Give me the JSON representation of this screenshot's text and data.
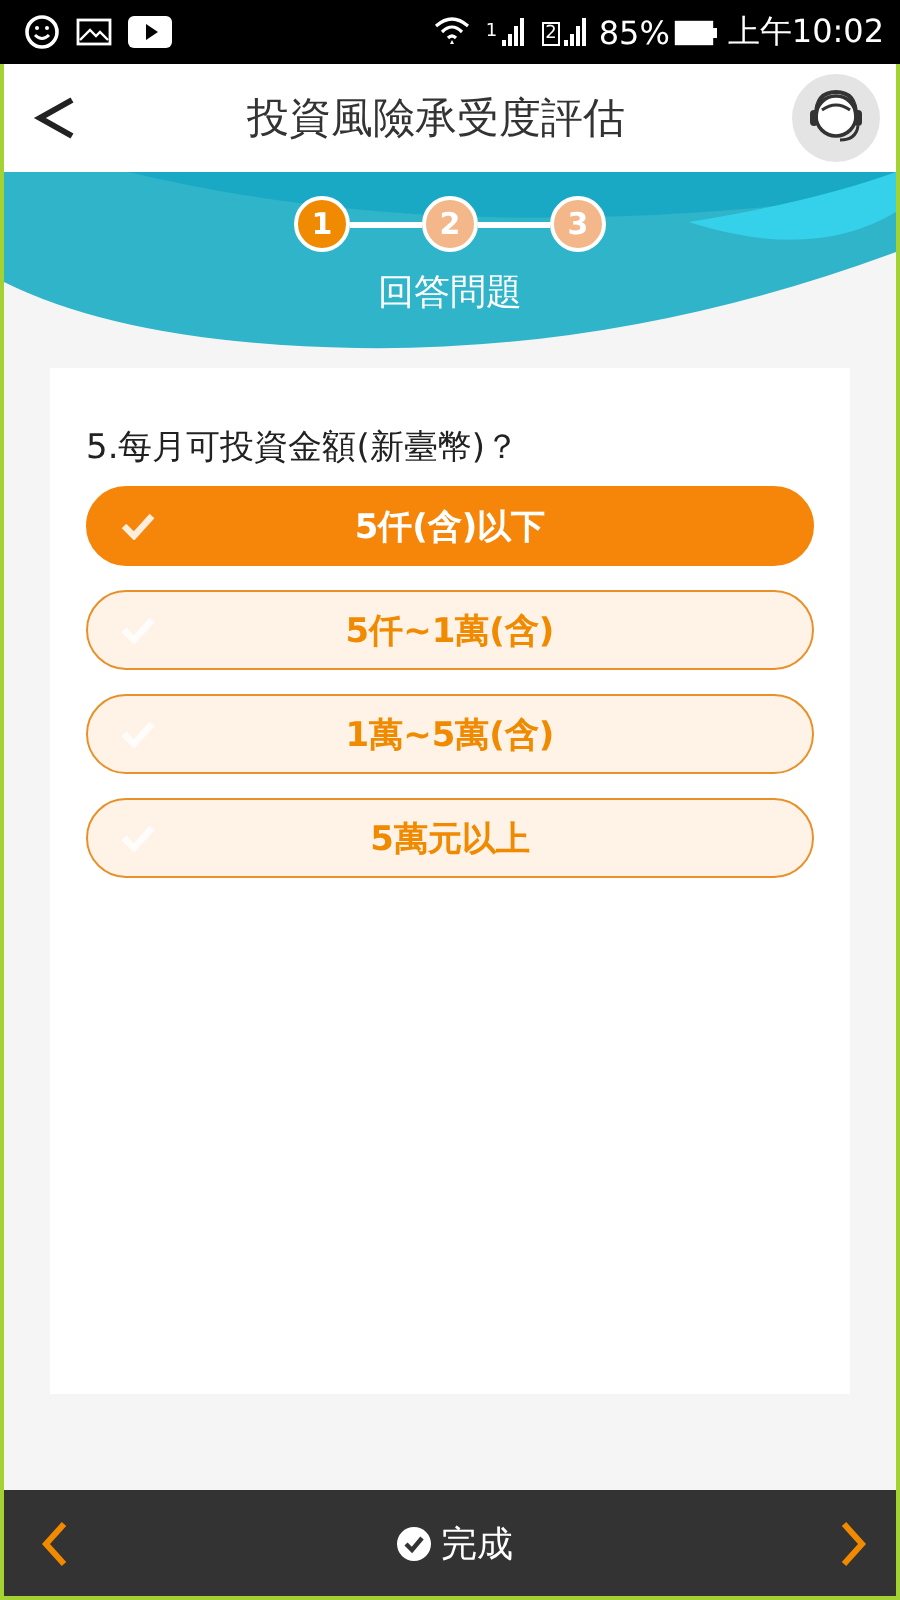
{
  "status_bar": {
    "sim_1": "1",
    "sim_2": "2",
    "battery": "85%",
    "time": "上午10:02"
  },
  "header": {
    "title": "投資風險承受度評估"
  },
  "steps": [
    {
      "label": "1",
      "selected": true
    },
    {
      "label": "2",
      "selected": false
    },
    {
      "label": "3",
      "selected": false
    }
  ],
  "step_title": "回答問題",
  "question": "5.每月可投資金額(新臺幣)？",
  "options": [
    {
      "label": "5仟(含)以下",
      "selected": true
    },
    {
      "label": "5仟~1萬(含)",
      "selected": false
    },
    {
      "label": "1萬~5萬(含)",
      "selected": false
    },
    {
      "label": "5萬元以上",
      "selected": false
    }
  ],
  "footer": {
    "done": "完成"
  }
}
